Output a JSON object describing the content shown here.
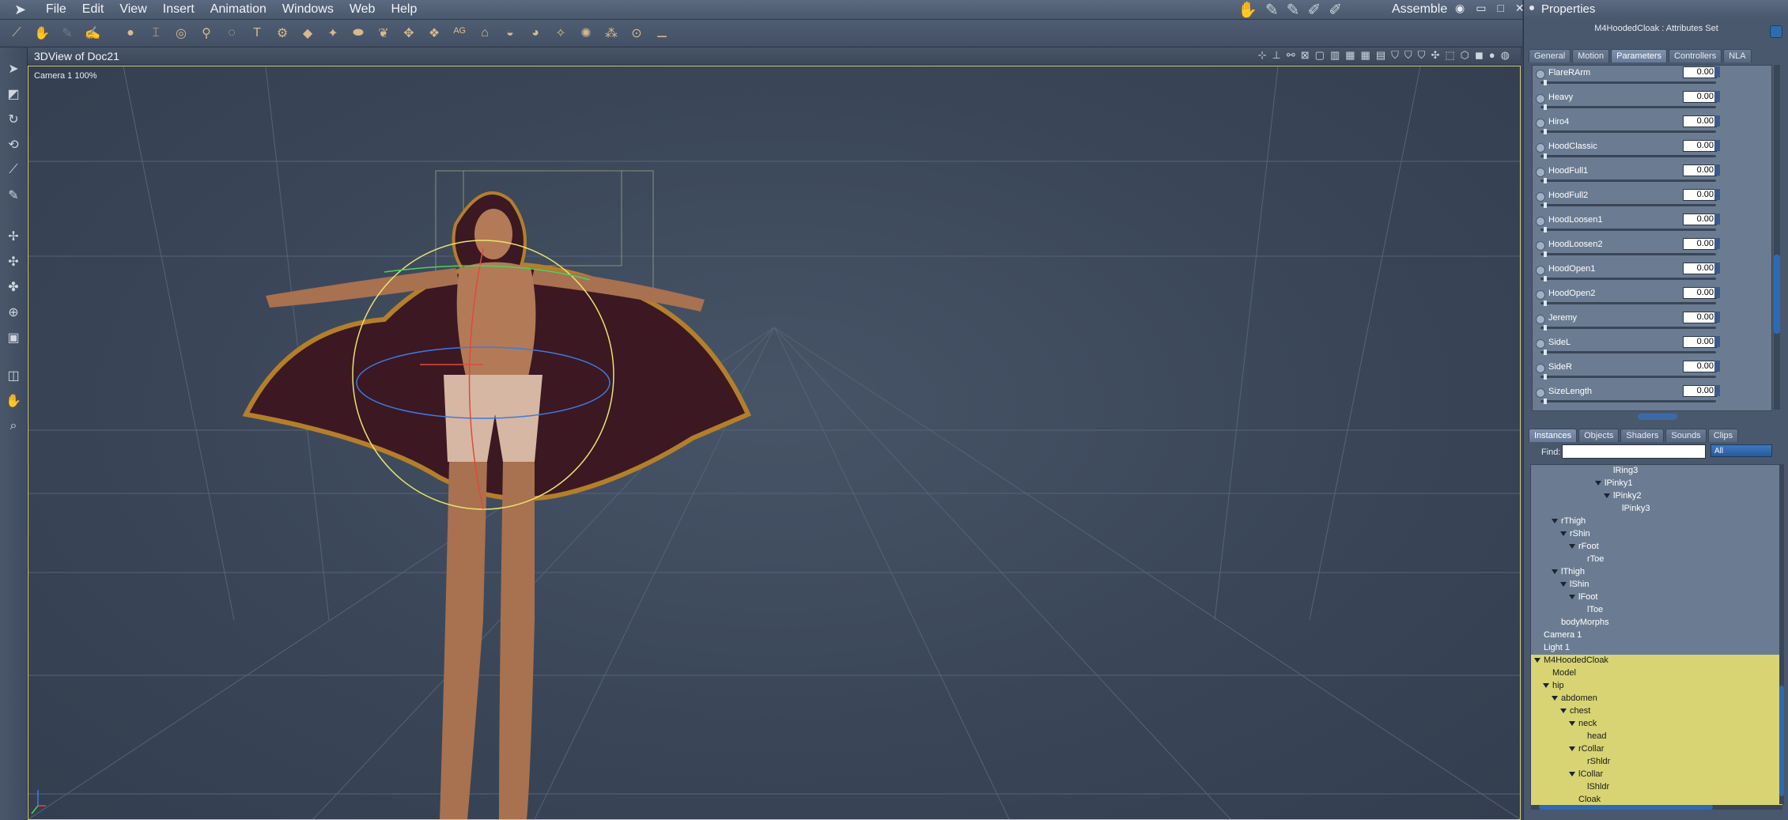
{
  "menubar": {
    "menus": [
      "File",
      "Edit",
      "View",
      "Insert",
      "Animation",
      "Windows",
      "Web",
      "Help"
    ],
    "room_label": "Assemble"
  },
  "viewport": {
    "title": "3DView of Doc21",
    "camera_label": "Camera 1 100%"
  },
  "properties": {
    "title": "Properties",
    "subtitle": "M4HoodedCloak : Attributes Set",
    "tabs": [
      "General",
      "Motion",
      "Parameters",
      "Controllers",
      "NLA"
    ],
    "active_tab": "Parameters",
    "parameters": [
      {
        "name": "FlareRArm",
        "value": "0.00"
      },
      {
        "name": "Heavy",
        "value": "0.00"
      },
      {
        "name": "Hiro4",
        "value": "0.00"
      },
      {
        "name": "HoodClassic",
        "value": "0.00"
      },
      {
        "name": "HoodFull1",
        "value": "0.00"
      },
      {
        "name": "HoodFull2",
        "value": "0.00"
      },
      {
        "name": "HoodLoosen1",
        "value": "0.00"
      },
      {
        "name": "HoodLoosen2",
        "value": "0.00"
      },
      {
        "name": "HoodOpen1",
        "value": "0.00"
      },
      {
        "name": "HoodOpen2",
        "value": "0.00"
      },
      {
        "name": "Jeremy",
        "value": "0.00"
      },
      {
        "name": "SideL",
        "value": "0.00"
      },
      {
        "name": "SideR",
        "value": "0.00"
      },
      {
        "name": "SizeLength",
        "value": "0.00"
      }
    ]
  },
  "instances": {
    "tabs": [
      "Instances",
      "Objects",
      "Shaders",
      "Sounds",
      "Clips"
    ],
    "active_tab": "Instances",
    "find_label": "Find:",
    "find_value": "",
    "filter_value": "All",
    "tree": [
      {
        "label": "lRing3",
        "depth": 8,
        "expanded": false,
        "selected": false
      },
      {
        "label": "lPinky1",
        "depth": 7,
        "expanded": true,
        "selected": false
      },
      {
        "label": "lPinky2",
        "depth": 8,
        "expanded": true,
        "selected": false
      },
      {
        "label": "lPinky3",
        "depth": 9,
        "expanded": false,
        "selected": false
      },
      {
        "label": "rThigh",
        "depth": 2,
        "expanded": true,
        "selected": false
      },
      {
        "label": "rShin",
        "depth": 3,
        "expanded": true,
        "selected": false
      },
      {
        "label": "rFoot",
        "depth": 4,
        "expanded": true,
        "selected": false
      },
      {
        "label": "rToe",
        "depth": 5,
        "expanded": false,
        "selected": false
      },
      {
        "label": "lThigh",
        "depth": 2,
        "expanded": true,
        "selected": false
      },
      {
        "label": "lShin",
        "depth": 3,
        "expanded": true,
        "selected": false
      },
      {
        "label": "lFoot",
        "depth": 4,
        "expanded": true,
        "selected": false
      },
      {
        "label": "lToe",
        "depth": 5,
        "expanded": false,
        "selected": false
      },
      {
        "label": "bodyMorphs",
        "depth": 2,
        "expanded": false,
        "selected": false
      },
      {
        "label": "Camera 1",
        "depth": 0,
        "expanded": false,
        "selected": false
      },
      {
        "label": "Light 1",
        "depth": 0,
        "expanded": false,
        "selected": false
      },
      {
        "label": "M4HoodedCloak",
        "depth": 0,
        "expanded": true,
        "selected": true
      },
      {
        "label": "Model",
        "depth": 1,
        "expanded": false,
        "selected": true
      },
      {
        "label": "hip",
        "depth": 1,
        "expanded": true,
        "selected": true
      },
      {
        "label": "abdomen",
        "depth": 2,
        "expanded": true,
        "selected": true
      },
      {
        "label": "chest",
        "depth": 3,
        "expanded": true,
        "selected": true
      },
      {
        "label": "neck",
        "depth": 4,
        "expanded": true,
        "selected": true
      },
      {
        "label": "head",
        "depth": 5,
        "expanded": false,
        "selected": true
      },
      {
        "label": "rCollar",
        "depth": 4,
        "expanded": true,
        "selected": true
      },
      {
        "label": "rShldr",
        "depth": 5,
        "expanded": false,
        "selected": true
      },
      {
        "label": "lCollar",
        "depth": 4,
        "expanded": true,
        "selected": true
      },
      {
        "label": "lShldr",
        "depth": 5,
        "expanded": false,
        "selected": true
      },
      {
        "label": "Cloak",
        "depth": 4,
        "expanded": false,
        "selected": true
      }
    ]
  },
  "icons": {
    "toolbar": [
      "select-arrow-icon",
      "disabled-tool-icon",
      "disabled-tool-icon",
      "hand-tool-icon",
      "sphere-icon",
      "cylinder-icon",
      "torus-icon",
      "bone-icon",
      "ring-icon",
      "text-3d-icon",
      "gear-icon",
      "mesh-icon",
      "light-icon",
      "plane-icon",
      "skinning-icon",
      "grid-icon",
      "ago-icon",
      "house-icon",
      "pot-icon",
      "paint-icon",
      "wand-icon",
      "star-icon",
      "nodes-icon",
      "target-icon",
      "pin-icon"
    ],
    "left": [
      "pointer-icon",
      "rotate-view-icon",
      "twist-icon",
      "curve-icon",
      "knife-icon",
      "pen-icon",
      "move-icon",
      "scale-icon",
      "rotate-icon",
      "globe-icon",
      "box-icon",
      "camera-icon",
      "hand-icon",
      "zoom-icon"
    ]
  }
}
